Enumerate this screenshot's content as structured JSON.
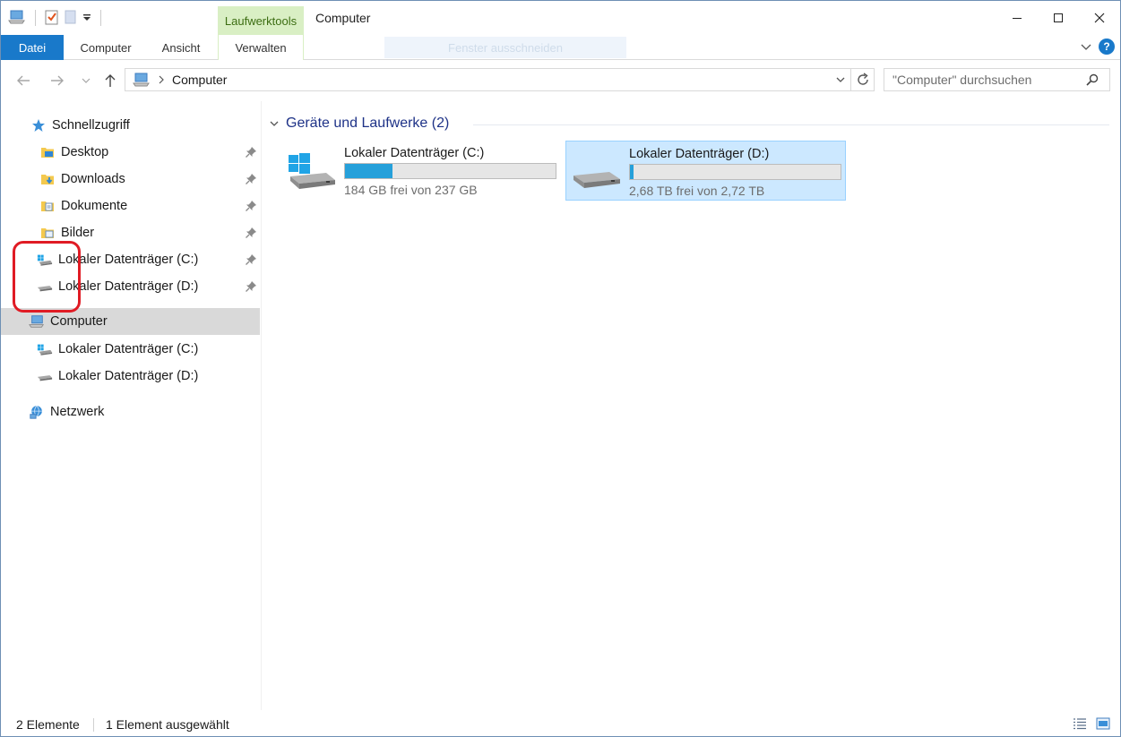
{
  "window": {
    "title": "Computer",
    "context_tab": "Laufwerktools"
  },
  "ribbon": {
    "tabs": [
      {
        "label": "Datei"
      },
      {
        "label": "Computer"
      },
      {
        "label": "Ansicht"
      },
      {
        "label": "Verwalten"
      }
    ],
    "ghost_tooltip": "Fenster ausschneiden",
    "help_label": "?"
  },
  "address": {
    "path": "Computer",
    "search_placeholder": "\"Computer\" durchsuchen"
  },
  "navpane": {
    "quick_access": "Schnellzugriff",
    "pinned": [
      {
        "label": "Desktop",
        "icon": "desktop-folder-icon"
      },
      {
        "label": "Downloads",
        "icon": "downloads-folder-icon"
      },
      {
        "label": "Dokumente",
        "icon": "documents-folder-icon"
      },
      {
        "label": "Bilder",
        "icon": "pictures-folder-icon"
      },
      {
        "label": "Lokaler Datenträger (C:)",
        "icon": "windows-drive-icon"
      },
      {
        "label": "Lokaler Datenträger (D:)",
        "icon": "drive-icon"
      }
    ],
    "computer": "Computer",
    "computer_drives": [
      {
        "label": "Lokaler Datenträger (C:)",
        "icon": "windows-drive-icon"
      },
      {
        "label": "Lokaler Datenträger (D:)",
        "icon": "drive-icon"
      }
    ],
    "network": "Netzwerk"
  },
  "content": {
    "group_title": "Geräte und Laufwerke (2)",
    "drives": [
      {
        "name": "Lokaler Datenträger (C:)",
        "free": "184 GB frei von 237 GB",
        "used_fraction": 0.224,
        "selected": false
      },
      {
        "name": "Lokaler Datenträger (D:)",
        "free": "2,68 TB frei von 2,72 TB",
        "used_fraction": 0.015,
        "selected": true
      }
    ]
  },
  "status": {
    "count": "2 Elemente",
    "selection": "1 Element ausgewählt"
  },
  "colors": {
    "accent": "#1979ca",
    "context_green": "#d9efc4",
    "selection": "#cce8ff",
    "bar_fill": "#26a0da",
    "highlight_ring": "#e01b24"
  }
}
